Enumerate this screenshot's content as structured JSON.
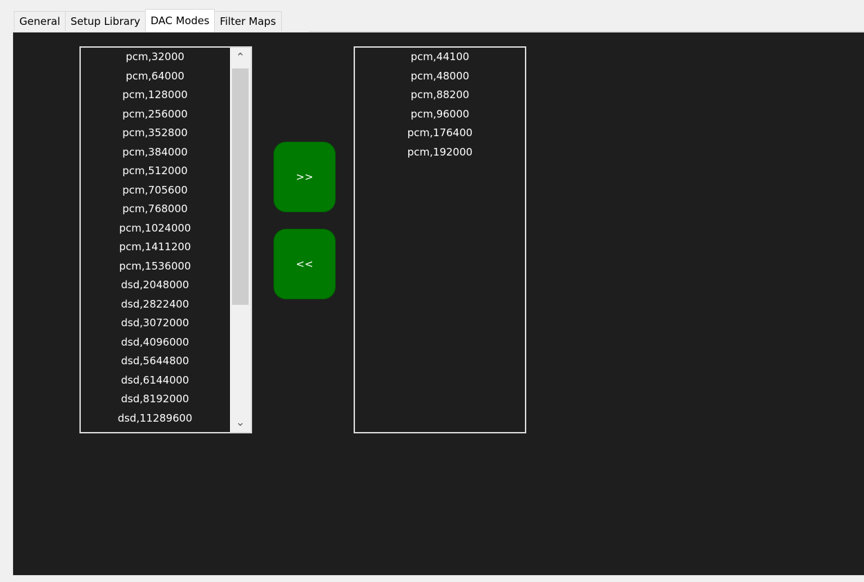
{
  "tabs": [
    {
      "label": "General"
    },
    {
      "label": "Setup Library"
    },
    {
      "label": "DAC Modes"
    },
    {
      "label": "Filter Maps"
    }
  ],
  "active_tab": "DAC Modes",
  "available_modes": [
    "pcm,32000",
    "pcm,64000",
    "pcm,128000",
    "pcm,256000",
    "pcm,352800",
    "pcm,384000",
    "pcm,512000",
    "pcm,705600",
    "pcm,768000",
    "pcm,1024000",
    "pcm,1411200",
    "pcm,1536000",
    "dsd,2048000",
    "dsd,2822400",
    "dsd,3072000",
    "dsd,4096000",
    "dsd,5644800",
    "dsd,6144000",
    "dsd,8192000",
    "dsd,11289600"
  ],
  "selected_modes": [
    "pcm,44100",
    "pcm,48000",
    "pcm,88200",
    "pcm,96000",
    "pcm,176400",
    "pcm,192000"
  ],
  "buttons": {
    "add_label": ">>",
    "remove_label": "<<"
  },
  "colors": {
    "panel_background": "#1e1e1e",
    "button_green": "#007a00",
    "list_text": "#ffffff"
  }
}
